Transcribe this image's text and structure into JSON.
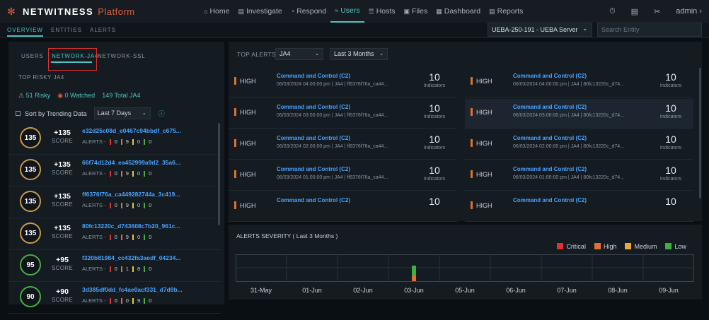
{
  "app": {
    "brand": "NETWITNESS",
    "brand_suffix": "Platform"
  },
  "nav": [
    {
      "icon": "⌂",
      "label": "Home"
    },
    {
      "icon": "▤",
      "label": "Investigate"
    },
    {
      "icon": "◔",
      "label": "Respond"
    },
    {
      "icon": "≈",
      "label": "Users",
      "active": true
    },
    {
      "icon": "☰",
      "label": "Hosts"
    },
    {
      "icon": "▣",
      "label": "Files"
    },
    {
      "icon": "▦",
      "label": "Dashboard"
    },
    {
      "icon": "▤",
      "label": "Reports"
    }
  ],
  "user": {
    "name": "admin",
    "caret": "›"
  },
  "subtabs": [
    "OVERVIEW",
    "ENTITIES",
    "ALERTS"
  ],
  "server": {
    "value": "UEBA-250-191 - UEBA Server"
  },
  "search": {
    "placeholder": "Search Entity"
  },
  "left": {
    "tabs": [
      "USERS",
      "NETWORK-JA4",
      "NETWORK-SSL"
    ],
    "title": "TOP RISKY JA4",
    "risky": "51 Risky",
    "watched": "0 Watched",
    "total": "149 Total JA4",
    "sort_label": "Sort by Trending Data",
    "sort_value": "Last 7 Days",
    "entities": [
      {
        "score": "135",
        "delta": "+135",
        "name": "e32d25c08d_e0467c94bbdf_c675...",
        "c": "0",
        "h": "9",
        "m": "0",
        "l": "0",
        "tier": "high"
      },
      {
        "score": "135",
        "delta": "+135",
        "name": "66f74d12d4_ea452999a9d2_35a6...",
        "c": "0",
        "h": "9",
        "m": "0",
        "l": "0",
        "tier": "high"
      },
      {
        "score": "135",
        "delta": "+135",
        "name": "ff6376f76a_ca449282744a_3c419...",
        "c": "0",
        "h": "9",
        "m": "0",
        "l": "0",
        "tier": "high"
      },
      {
        "score": "135",
        "delta": "+135",
        "name": "80fc13220c_d743608c7b20_961c...",
        "c": "0",
        "h": "9",
        "m": "0",
        "l": "0",
        "tier": "high"
      },
      {
        "score": "95",
        "delta": "+95",
        "name": "f320b81984_cc432fa3aedf_04234...",
        "c": "0",
        "h": "1",
        "m": "8",
        "l": "0",
        "tier": "low"
      },
      {
        "score": "90",
        "delta": "+90",
        "name": "3d385df0dd_fc4ae0acf331_d7d9b...",
        "c": "0",
        "h": "0",
        "m": "9",
        "l": "0",
        "tier": "low"
      }
    ],
    "score_label": "SCORE",
    "alerts_label": "ALERTS"
  },
  "top_alerts": {
    "title": "TOP ALERTS",
    "filter": "JA4",
    "period": "Last 3 Months",
    "indicators_label": "Indicators",
    "left": [
      {
        "sev": "HIGH",
        "title": "Command and Control (C2)",
        "meta": "06/03/2024 04:00:00 pm  |  JA4  |  ff6376f76a_ca44...",
        "count": "10"
      },
      {
        "sev": "HIGH",
        "title": "Command and Control (C2)",
        "meta": "06/03/2024 03:00:00 pm  |  JA4  |  ff6376f76a_ca44...",
        "count": "10"
      },
      {
        "sev": "HIGH",
        "title": "Command and Control (C2)",
        "meta": "06/03/2024 02:00:00 pm  |  JA4  |  ff6376f76a_ca44...",
        "count": "10"
      },
      {
        "sev": "HIGH",
        "title": "Command and Control (C2)",
        "meta": "06/03/2024 01:00:00 pm  |  JA4  |  ff6376f76a_ca44...",
        "count": "10"
      },
      {
        "sev": "HIGH",
        "title": "Command and Control (C2)",
        "meta": "",
        "count": "10"
      }
    ],
    "right": [
      {
        "sev": "HIGH",
        "title": "Command and Control (C2)",
        "meta": "06/03/2024 04:00:00 pm  |  JA4  |  80fc13220c_d74...",
        "count": "10"
      },
      {
        "sev": "HIGH",
        "title": "Command and Control (C2)",
        "meta": "06/03/2024 03:00:00 pm  |  JA4  |  80fc13220c_d74...",
        "count": "10"
      },
      {
        "sev": "HIGH",
        "title": "Command and Control (C2)",
        "meta": "06/03/2024 02:00:00 pm  |  JA4  |  80fc13220c_d74...",
        "count": "10"
      },
      {
        "sev": "HIGH",
        "title": "Command and Control (C2)",
        "meta": "06/03/2024 01:00:00 pm  |  JA4  |  80fc13220c_d74...",
        "count": "10"
      },
      {
        "sev": "HIGH",
        "title": "Command and Control (C2)",
        "meta": "",
        "count": "10"
      }
    ]
  },
  "severity": {
    "title": "ALERTS SEVERITY ( Last 3 Months )",
    "legend": [
      {
        "label": "Critical",
        "color": "#e03030"
      },
      {
        "label": "High",
        "color": "#e07030"
      },
      {
        "label": "Medium",
        "color": "#e6a93a"
      },
      {
        "label": "Low",
        "color": "#3fb03f"
      }
    ]
  },
  "chart_data": {
    "type": "bar",
    "title": "ALERTS SEVERITY ( Last 3 Months )",
    "categories": [
      "31-May",
      "01-Jun",
      "02-Jun",
      "03-Jun",
      "05-Jun",
      "06-Jun",
      "07-Jun",
      "08-Jun",
      "09-Jun"
    ],
    "series": [
      {
        "name": "Critical",
        "color": "#e03030",
        "values": [
          0,
          0,
          0,
          0,
          0,
          0,
          0,
          0,
          0
        ]
      },
      {
        "name": "High",
        "color": "#e07030",
        "values": [
          0,
          0,
          0,
          8,
          0,
          0,
          0,
          0,
          0
        ]
      },
      {
        "name": "Medium",
        "color": "#e6a93a",
        "values": [
          0,
          0,
          0,
          0,
          0,
          0,
          0,
          0,
          0
        ]
      },
      {
        "name": "Low",
        "color": "#3fb03f",
        "values": [
          0,
          0,
          0,
          14,
          0,
          0,
          0,
          0,
          0
        ]
      }
    ],
    "stacked": true,
    "legend": "top-right",
    "grid": true
  },
  "colors": {
    "accent": "#4dc3c3",
    "link": "#4aa3ff",
    "high": "#e07030",
    "critical": "#e03030"
  }
}
